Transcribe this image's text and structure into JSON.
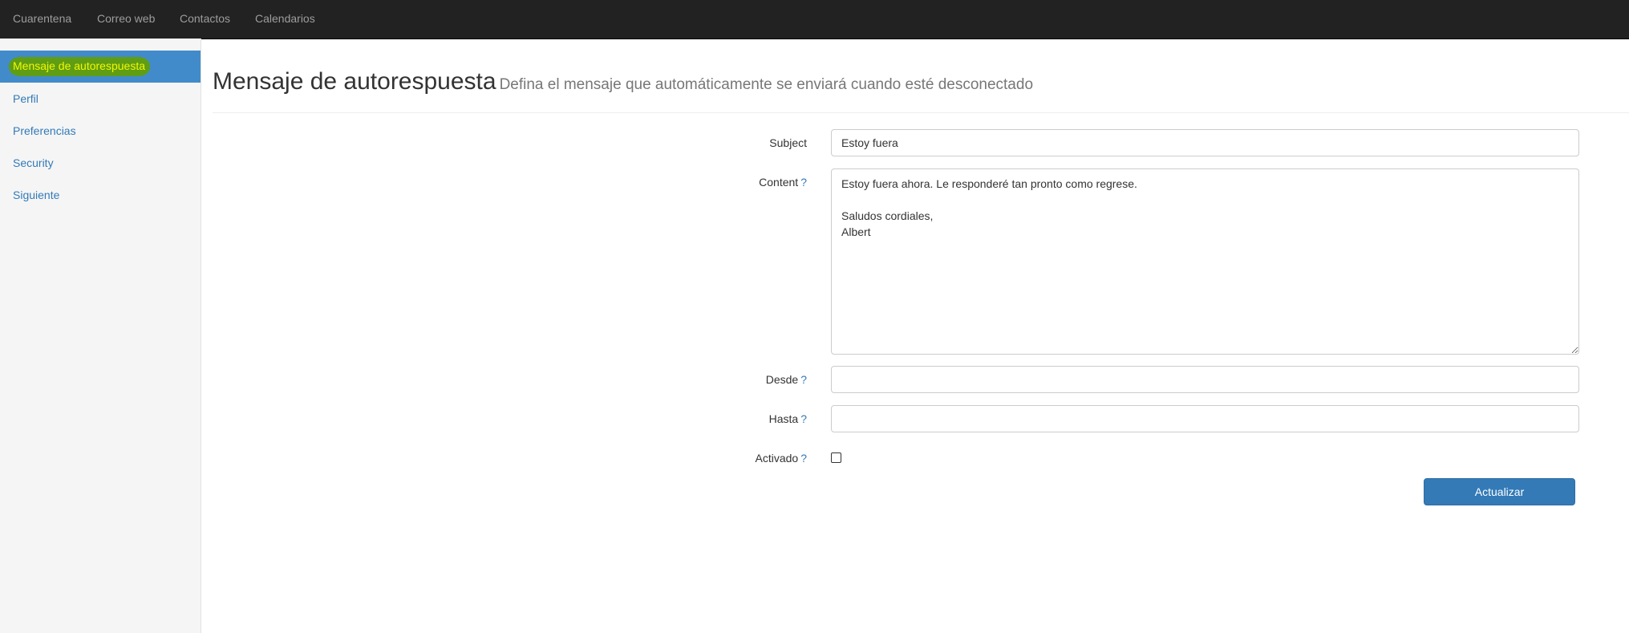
{
  "topnav": {
    "items": [
      {
        "label": "Cuarentena"
      },
      {
        "label": "Correo web"
      },
      {
        "label": "Contactos"
      },
      {
        "label": "Calendarios"
      }
    ]
  },
  "sidebar": {
    "items": [
      {
        "label": "Mensaje de autorespuesta",
        "active": true
      },
      {
        "label": "Perfil"
      },
      {
        "label": "Preferencias"
      },
      {
        "label": "Security"
      },
      {
        "label": "Siguiente"
      }
    ]
  },
  "header": {
    "title": "Mensaje de autorespuesta",
    "subtitle": "Defina el mensaje que automáticamente se enviará cuando esté desconectado"
  },
  "form": {
    "subject_label": "Subject",
    "subject_value": "Estoy fuera",
    "content_label": "Content",
    "content_help": "?",
    "content_value": "Estoy fuera ahora. Le responderé tan pronto como regrese.\n\nSaludos cordiales,\nAlbert",
    "desde_label": "Desde",
    "desde_help": "?",
    "desde_value": "",
    "hasta_label": "Hasta",
    "hasta_help": "?",
    "hasta_value": "",
    "activado_label": "Activado",
    "activado_help": "?",
    "activado_checked": false,
    "submit_label": "Actualizar"
  },
  "colors": {
    "navbar": "#222222",
    "accent": "#337ab7",
    "active_item": "#428bca",
    "highlight": "#5f9d14"
  }
}
